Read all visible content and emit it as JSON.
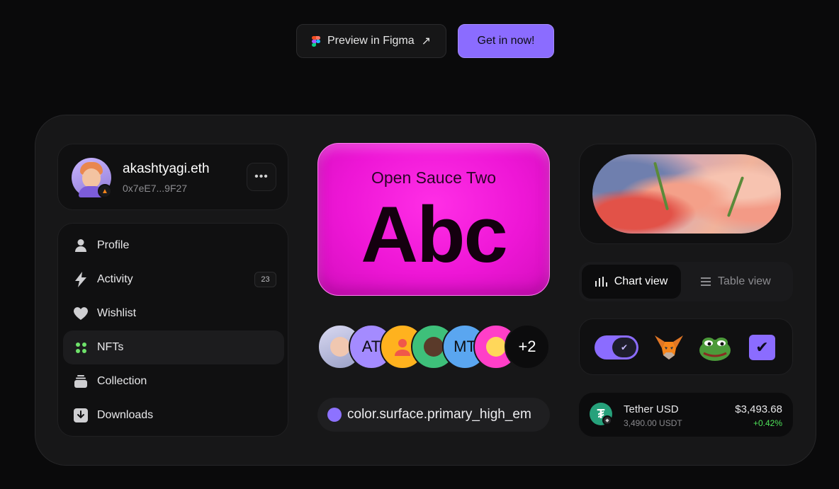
{
  "actions": {
    "figma_label": "Preview in Figma",
    "cta_label": "Get in now!"
  },
  "profile": {
    "name": "akashtyagi.eth",
    "address": "0x7eE7...9F27",
    "more_icon": "ellipsis-icon"
  },
  "nav": {
    "items": [
      {
        "label": "Profile",
        "icon": "user-icon"
      },
      {
        "label": "Activity",
        "icon": "lightning-icon",
        "badge": "23"
      },
      {
        "label": "Wishlist",
        "icon": "heart-icon"
      },
      {
        "label": "NFTs",
        "icon": "grid-dots-icon",
        "active": true
      },
      {
        "label": "Collection",
        "icon": "stack-icon"
      },
      {
        "label": "Downloads",
        "icon": "download-icon"
      }
    ]
  },
  "font_card": {
    "font_name": "Open Sauce Two",
    "sample": "Abc"
  },
  "avatars": {
    "initials_1": "AT",
    "initials_2": "MT",
    "more": "+2"
  },
  "token_pill": {
    "label": "color.surface.primary_high_em"
  },
  "view_toggle": {
    "chart_label": "Chart view",
    "table_label": "Table view",
    "selected": "Chart view"
  },
  "controls": {
    "toggle_on": true,
    "checkbox_checked": true
  },
  "token": {
    "name": "Tether USD",
    "amount": "3,490.00 USDT",
    "usd": "$3,493.68",
    "change": "+0.42%"
  },
  "colors": {
    "accent": "#8b6cff",
    "font_card": "#ee16d6",
    "positive": "#4fe35a",
    "nft_green": "#6ee26a",
    "tether": "#26a17b"
  }
}
